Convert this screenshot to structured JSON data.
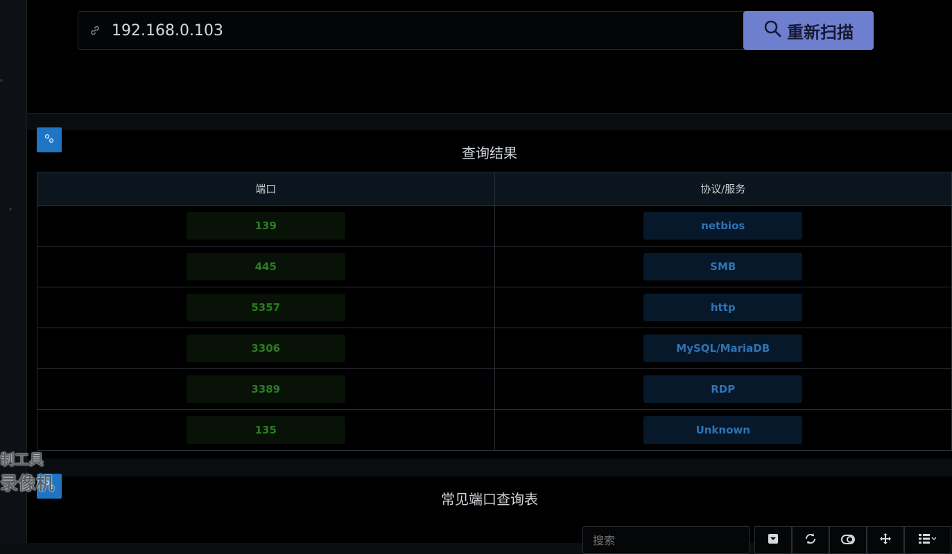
{
  "search": {
    "url_value": "192.168.0.103",
    "scan_label": "重新扫描"
  },
  "result": {
    "title": "查询结果",
    "columns": [
      "端口",
      "协议/服务"
    ],
    "rows": [
      {
        "port": "139",
        "service": "netbios"
      },
      {
        "port": "445",
        "service": "SMB"
      },
      {
        "port": "5357",
        "service": "http"
      },
      {
        "port": "3306",
        "service": "MySQL/MariaDB"
      },
      {
        "port": "3389",
        "service": "RDP"
      },
      {
        "port": "135",
        "service": "Unknown"
      }
    ]
  },
  "common_ports": {
    "title": "常见端口查询表",
    "search_placeholder": "搜索"
  },
  "toolbar_icons": [
    "dropdown-box-icon",
    "refresh-icon",
    "toggle-icon",
    "move-icon",
    "list-icon"
  ],
  "watermark": {
    "line1": "制工具",
    "line2": "录像机"
  },
  "colors": {
    "accent_button": "#6f7fd0",
    "corner_button": "#1f74c4",
    "port_text": "#2b7d22",
    "service_text": "#2f73b3"
  }
}
